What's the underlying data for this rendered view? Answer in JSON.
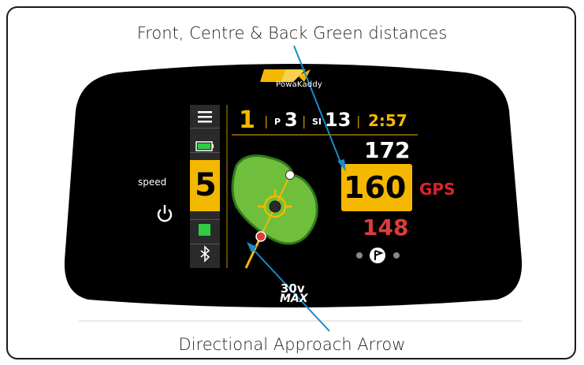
{
  "captions": {
    "top": "Front, Centre & Back Green distances",
    "bottom": "Directional Approach Arrow"
  },
  "brand": {
    "logo_text": "PowaKaddy",
    "model_top": "30v",
    "model_bottom": "MAX"
  },
  "screen": {
    "hole_number": "1",
    "par_label": "P",
    "par_value": "3",
    "si_label": "SI",
    "si_value": "13",
    "time": "2:57",
    "speed_label": "speed",
    "speed_value": "5",
    "distances": {
      "back": "172",
      "centre": "160",
      "front": "148"
    },
    "gps_label": "GPS"
  },
  "colors": {
    "accent_yellow": "#f5b800",
    "green_fill": "#6fbf3d",
    "green_edge": "#2f7a1f",
    "front_red": "#e03a3a",
    "gps_red": "#d8232a",
    "battery_green": "#2ecc40"
  },
  "icons": [
    "menu-icon",
    "battery-icon",
    "stop-icon",
    "bluetooth-icon",
    "power-icon",
    "flag-icon"
  ]
}
